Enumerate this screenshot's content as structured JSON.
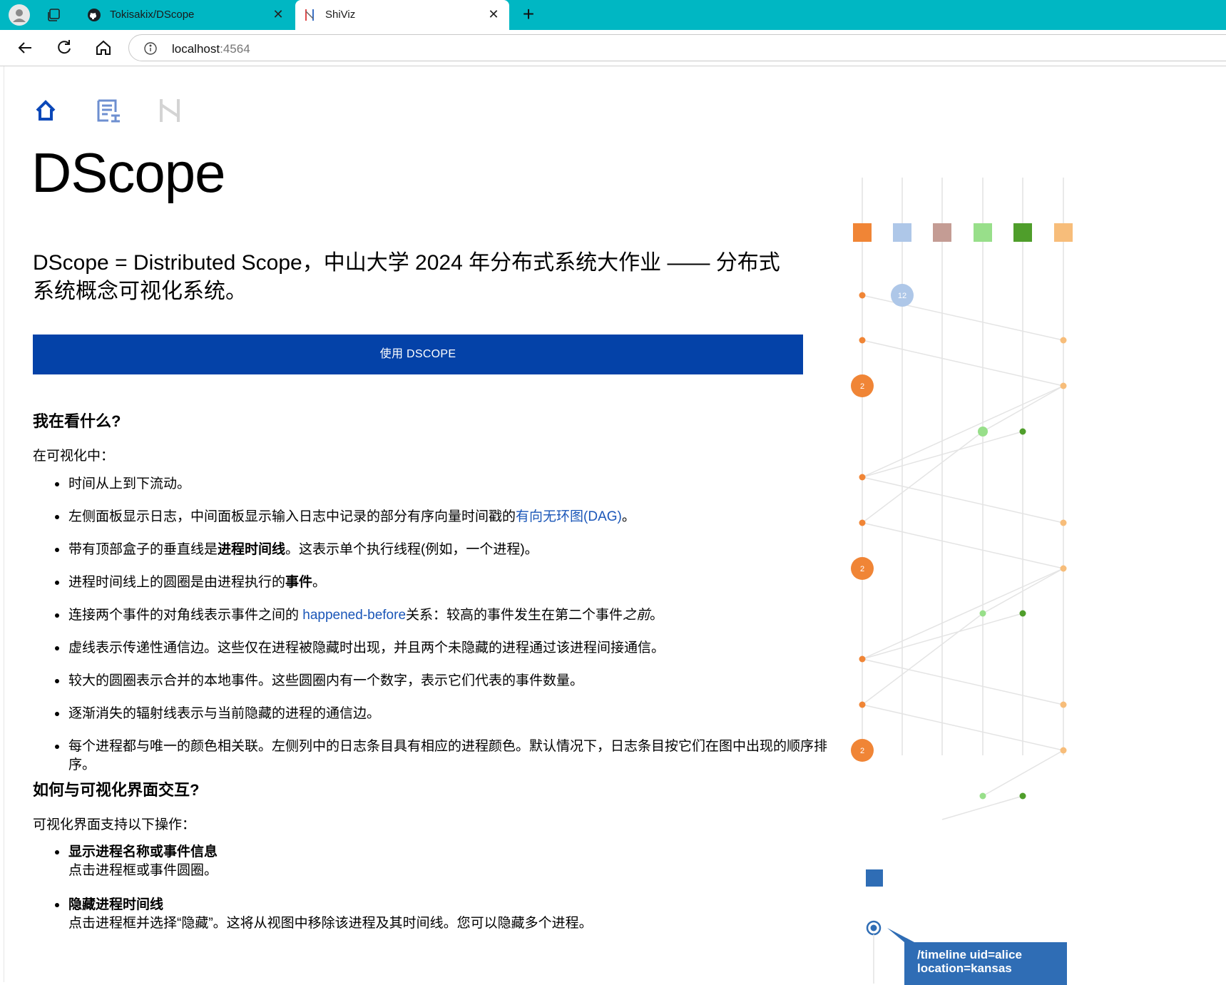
{
  "browser": {
    "tabs": [
      {
        "title": "Tokisakix/DScope",
        "icon": "github-icon",
        "active": false
      },
      {
        "title": "ShiViz",
        "icon": "shiviz-icon",
        "active": true
      }
    ],
    "address": {
      "host": "localhost",
      "port": ":4564"
    },
    "accent_color": "#00b7c3"
  },
  "page": {
    "nav_icons": [
      "home-icon",
      "log-document-icon",
      "graph-icon"
    ],
    "title": "DScope",
    "subtitle": "DScope = Distributed Scope，中山大学 2024 年分布式系统大作业 —— 分布式系统概念可视化系统。",
    "cta_label": "使用 DSCOPE",
    "cta_color": "#0442a8",
    "section1": {
      "heading": "我在看什么?",
      "intro": "在可视化中：",
      "items": {
        "i1": "时间从上到下流动。",
        "i2_pre": "左侧面板显示日志，中间面板显示输入日志中记录的部分有序向量时间戳的",
        "i2_link": "有向无环图(DAG)",
        "i2_post": "。",
        "i3_pre": "带有顶部盒子的垂直线是",
        "i3_bold": "进程时间线",
        "i3_post": "。这表示单个执行线程(例如，一个进程)。",
        "i4_pre": "进程时间线上的圆圈是由进程执行的",
        "i4_bold": "事件",
        "i4_post": "。",
        "i5_pre": "连接两个事件的对角线表示事件之间的 ",
        "i5_link": "happened-before",
        "i5_mid": "关系：较高的事件发生在第二个事件",
        "i5_italic": "之前",
        "i5_post": "。",
        "i6": "虚线表示传递性通信边。这些仅在进程被隐藏时出现，并且两个未隐藏的进程通过该进程间接通信。",
        "i7": "较大的圆圈表示合并的本地事件。这些圆圈内有一个数字，表示它们代表的事件数量。",
        "i8": "逐渐消失的辐射线表示与当前隐藏的进程的通信边。",
        "i9": "每个进程都与唯一的颜色相关联。左侧列中的日志条目具有相应的进程颜色。默认情况下，日志条目按它们在图中出现的顺序排序。"
      }
    },
    "section2": {
      "heading": "如何与可视化界面交互?",
      "intro": "可视化界面支持以下操作：",
      "items": [
        {
          "title": "显示进程名称或事件信息",
          "desc": "点击进程框或事件圆圈。"
        },
        {
          "title": "隐藏进程时间线",
          "desc": "点击进程框并选择“隐藏”。这将从视图中移除该进程及其时间线。您可以隐藏多个进程。"
        }
      ]
    },
    "viz": {
      "process_colors": [
        "#f08536",
        "#aec7e8",
        "#c49c94",
        "#98df8a",
        "#4f9e2b",
        "#f7bd7a"
      ],
      "merged_counts": [
        "12",
        "2",
        "2",
        "2"
      ],
      "tooltip": "/timeline uid=alice location=kansas"
    }
  }
}
